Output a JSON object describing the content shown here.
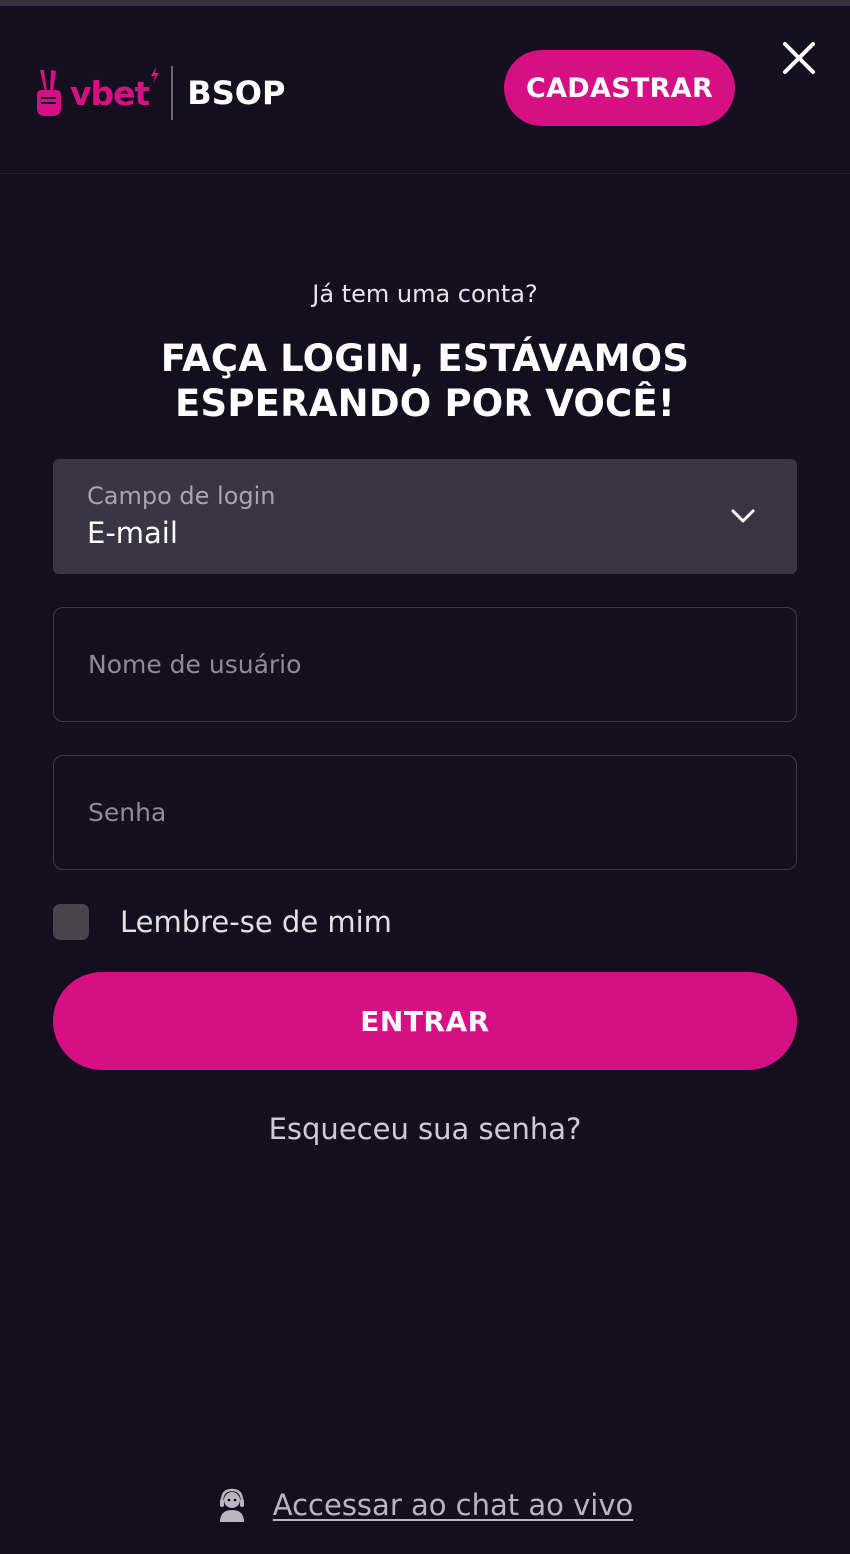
{
  "header": {
    "logo_vbet": "vbet",
    "logo_bsop": "BSOP",
    "register_label": "CADASTRAR",
    "close_icon": "close-icon"
  },
  "login": {
    "subtitle": "Já tem uma conta?",
    "title": "FAÇA LOGIN, ESTÁVAMOS ESPERANDO POR VOCÊ!",
    "login_field": {
      "label": "Campo de login",
      "value": "E-mail",
      "icon": "chevron-down-icon"
    },
    "username_placeholder": "Nome de usuário",
    "password_placeholder": "Senha",
    "remember_label": "Lembre-se de mim",
    "remember_checked": false,
    "submit_label": "ENTRAR",
    "forgot_label": "Esqueceu sua senha?"
  },
  "footer": {
    "chat_label": "Accessar ao chat ao vivo",
    "chat_icon": "support-agent-icon"
  },
  "colors": {
    "background": "#140f1f",
    "accent": "#d70f84",
    "select_background": "#3a3545"
  }
}
